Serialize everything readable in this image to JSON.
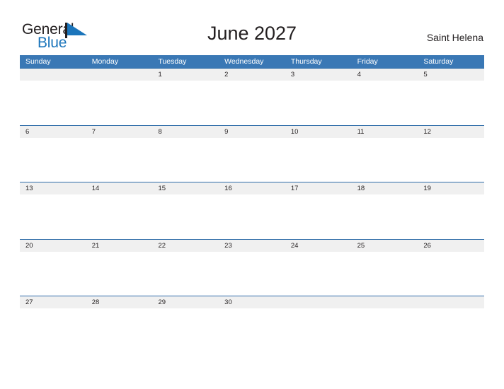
{
  "brand": {
    "name_part1": "General",
    "name_part2": "Blue",
    "flag_icon": "blue-triangle-flag-icon",
    "color_dark": "#231f20",
    "color_blue": "#1b75bb"
  },
  "header": {
    "title": "June 2027",
    "location": "Saint Helena"
  },
  "calendar": {
    "header_bg": "#3a78b5",
    "row_band_bg": "#f0f0f0",
    "row_border": "#2d6ba8",
    "weekdays": [
      "Sunday",
      "Monday",
      "Tuesday",
      "Wednesday",
      "Thursday",
      "Friday",
      "Saturday"
    ],
    "weeks": [
      [
        "",
        "",
        "1",
        "2",
        "3",
        "4",
        "5"
      ],
      [
        "6",
        "7",
        "8",
        "9",
        "10",
        "11",
        "12"
      ],
      [
        "13",
        "14",
        "15",
        "16",
        "17",
        "18",
        "19"
      ],
      [
        "20",
        "21",
        "22",
        "23",
        "24",
        "25",
        "26"
      ],
      [
        "27",
        "28",
        "29",
        "30",
        "",
        "",
        ""
      ]
    ]
  }
}
